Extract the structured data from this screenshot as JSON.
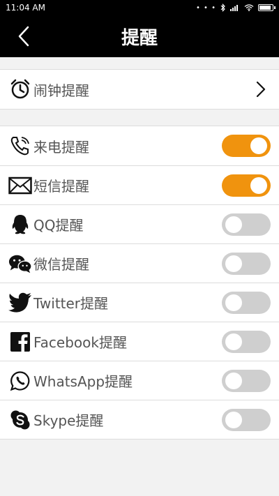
{
  "status": {
    "time": "11:04 AM",
    "dots": "• • •"
  },
  "header": {
    "title": "提醒"
  },
  "alarm": {
    "label": "闹钟提醒"
  },
  "items": [
    {
      "label": "来电提醒",
      "on": true,
      "icon": "phone-icon"
    },
    {
      "label": "短信提醒",
      "on": true,
      "icon": "envelope-icon"
    },
    {
      "label": "QQ提醒",
      "on": false,
      "icon": "qq-icon"
    },
    {
      "label": "微信提醒",
      "on": false,
      "icon": "wechat-icon"
    },
    {
      "label": "Twitter提醒",
      "on": false,
      "icon": "twitter-icon"
    },
    {
      "label": "Facebook提醒",
      "on": false,
      "icon": "facebook-icon"
    },
    {
      "label": "WhatsApp提醒",
      "on": false,
      "icon": "whatsapp-icon"
    },
    {
      "label": "Skype提醒",
      "on": false,
      "icon": "skype-icon"
    }
  ],
  "colors": {
    "toggle_on": "#f0930e",
    "toggle_off": "#cfcfcf"
  }
}
